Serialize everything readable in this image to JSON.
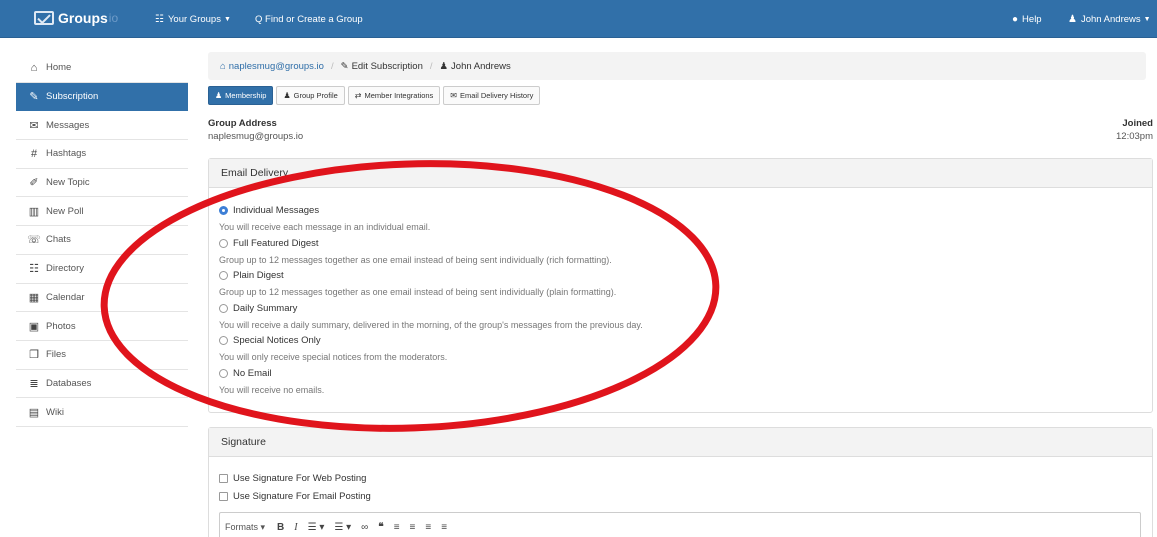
{
  "navbar": {
    "brand": "Groups",
    "brand_suffix": "io",
    "your_groups": "Your Groups",
    "find_group": "Q Find or Create a Group",
    "help": "Help",
    "user": "John Andrews"
  },
  "sidebar": {
    "items": [
      {
        "label": "Home",
        "icon": "home-icon",
        "glyph": "⌂"
      },
      {
        "label": "Subscription",
        "icon": "pencil-icon",
        "glyph": "✎"
      },
      {
        "label": "Messages",
        "icon": "messages-icon",
        "glyph": "✉"
      },
      {
        "label": "Hashtags",
        "icon": "hashtag-icon",
        "glyph": "#"
      },
      {
        "label": "New Topic",
        "icon": "edit-icon",
        "glyph": "✐"
      },
      {
        "label": "New Poll",
        "icon": "chart-icon",
        "glyph": "▥"
      },
      {
        "label": "Chats",
        "icon": "chat-icon",
        "glyph": "☏"
      },
      {
        "label": "Directory",
        "icon": "users-icon",
        "glyph": "☷"
      },
      {
        "label": "Calendar",
        "icon": "calendar-icon",
        "glyph": "▦"
      },
      {
        "label": "Photos",
        "icon": "photo-icon",
        "glyph": "▣"
      },
      {
        "label": "Files",
        "icon": "files-icon",
        "glyph": "❐"
      },
      {
        "label": "Databases",
        "icon": "database-icon",
        "glyph": "≣"
      },
      {
        "label": "Wiki",
        "icon": "wiki-icon",
        "glyph": "▤"
      }
    ],
    "active_index": 1
  },
  "breadcrumb": {
    "group": "naplesmug@groups.io",
    "page": "Edit Subscription",
    "user": "John Andrews"
  },
  "tabs": [
    {
      "label": "Membership",
      "icon": "user-icon",
      "glyph": "♟"
    },
    {
      "label": "Group Profile",
      "icon": "user-icon",
      "glyph": "♟"
    },
    {
      "label": "Member Integrations",
      "icon": "exchange-icon",
      "glyph": "⇄"
    },
    {
      "label": "Email Delivery History",
      "icon": "envelope-icon",
      "glyph": "✉"
    }
  ],
  "group_address": {
    "label": "Group Address",
    "value": "naplesmug@groups.io"
  },
  "joined": {
    "label": "Joined",
    "value": "12:03pm"
  },
  "email_delivery": {
    "title": "Email Delivery",
    "options": [
      {
        "label": "Individual Messages",
        "help": "You will receive each message in an individual email.",
        "selected": true
      },
      {
        "label": "Full Featured Digest",
        "help": "Group up to 12 messages together as one email instead of being sent individually (rich formatting).",
        "selected": false
      },
      {
        "label": "Plain Digest",
        "help": "Group up to 12 messages together as one email instead of being sent individually (plain formatting).",
        "selected": false
      },
      {
        "label": "Daily Summary",
        "help": "You will receive a daily summary, delivered in the morning, of the group's messages from the previous day.",
        "selected": false
      },
      {
        "label": "Special Notices Only",
        "help": "You will only receive special notices from the moderators.",
        "selected": false
      },
      {
        "label": "No Email",
        "help": "You will receive no emails.",
        "selected": false
      }
    ]
  },
  "signature": {
    "title": "Signature",
    "web_posting": "Use Signature For Web Posting",
    "email_posting": "Use Signature For Email Posting",
    "formats": "Formats"
  },
  "colors": {
    "primary": "#3170a9",
    "annotation": "#e0141c"
  }
}
